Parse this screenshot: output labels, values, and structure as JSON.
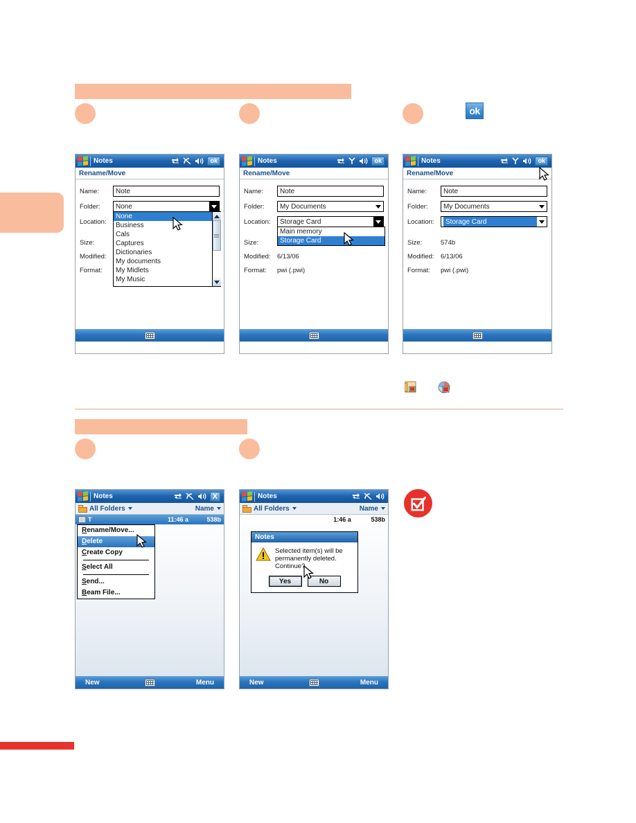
{
  "page": {
    "ok_badge_label": "ok",
    "accent_peach": "#f9bd9d",
    "accent_red": "#e8312a",
    "titlebar_blue": "#1e63ad"
  },
  "devices": {
    "rename_move_folder_open": {
      "app_title": "Notes",
      "screen_title": "Rename/Move",
      "titlebar_icons": [
        "connectivity-icon",
        "wifi-off-icon",
        "volume-icon"
      ],
      "titlebar_button": "ok",
      "fields": {
        "name_label": "Name:",
        "name_value": "Note",
        "folder_label": "Folder:",
        "folder_value": "None",
        "location_label": "Location:",
        "location_value": "",
        "size_label": "Size:",
        "size_value": "",
        "modified_label": "Modified:",
        "modified_value": "",
        "format_label": "Format:",
        "format_value": ""
      },
      "folder_options": [
        "None",
        "Business",
        "Cals",
        "Captures",
        "Dictionaries",
        "My documents",
        "My Midlets",
        "My Music"
      ],
      "folder_selected": "None"
    },
    "rename_move_location_open": {
      "app_title": "Notes",
      "screen_title": "Rename/Move",
      "titlebar_icons": [
        "connectivity-icon",
        "signal-icon",
        "volume-icon"
      ],
      "titlebar_button": "ok",
      "fields": {
        "name_label": "Name:",
        "name_value": "Note",
        "folder_label": "Folder:",
        "folder_value": "My Documents",
        "location_label": "Location:",
        "location_value": "Storage Card",
        "size_label": "Size:",
        "size_value": "",
        "modified_label": "Modified:",
        "modified_value": "6/13/06",
        "format_label": "Format:",
        "format_value": "pwi (.pwi)"
      },
      "location_options": [
        "Main memory",
        "Storage Card"
      ],
      "location_selected": "Storage Card"
    },
    "rename_move_done": {
      "app_title": "Notes",
      "screen_title": "Rename/Move",
      "titlebar_icons": [
        "connectivity-icon",
        "signal-icon",
        "volume-icon"
      ],
      "titlebar_button": "ok",
      "fields": {
        "name_label": "Name:",
        "name_value": "Note",
        "folder_label": "Folder:",
        "folder_value": "My Documents",
        "location_label": "Location:",
        "location_value": "Storage Card",
        "size_label": "Size:",
        "size_value": "574b",
        "modified_label": "Modified:",
        "modified_value": "6/13/06",
        "format_label": "Format:",
        "format_value": "pwi (.pwi)"
      }
    },
    "notes_context_menu": {
      "app_title": "Notes",
      "titlebar_icons": [
        "connectivity-icon",
        "wifi-off-icon",
        "volume-icon"
      ],
      "titlebar_button": "X",
      "folder_filter": "All Folders",
      "sort_by": "Name",
      "row": {
        "name": "T",
        "time": "11:46 a",
        "size": "538b"
      },
      "menu_items": [
        {
          "label": "Rename/Move...",
          "selected": false
        },
        {
          "label": "Delete",
          "selected": true
        },
        {
          "label": "Create Copy",
          "selected": false
        },
        {
          "label": "Select All",
          "selected": false
        },
        {
          "label": "Send...",
          "selected": false
        },
        {
          "label": "Beam File...",
          "selected": false
        }
      ],
      "softkeys": {
        "left": "New",
        "right": "Menu"
      }
    },
    "notes_delete_dialog": {
      "app_title": "Notes",
      "titlebar_icons": [
        "connectivity-icon",
        "wifi-off-icon",
        "volume-icon"
      ],
      "folder_filter": "All Folders",
      "sort_by": "Name",
      "row": {
        "time": "1:46 a",
        "size": "538b"
      },
      "dialog": {
        "title": "Notes",
        "message": "Selected item(s) will be permanently deleted. Continue?",
        "yes_label": "Yes",
        "no_label": "No"
      },
      "softkeys": {
        "left": "New",
        "right": "Menu"
      }
    }
  }
}
